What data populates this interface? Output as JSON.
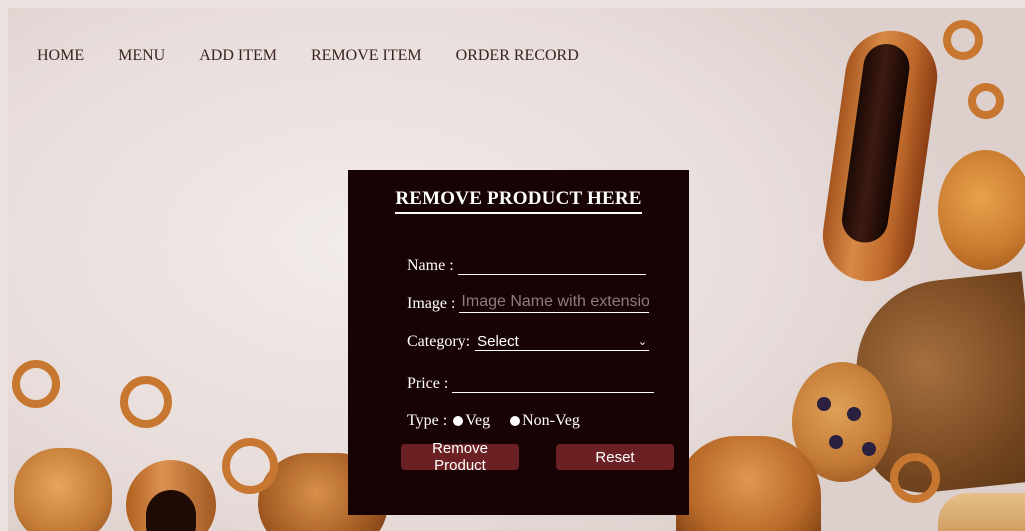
{
  "nav": {
    "items": [
      "HOME",
      "MENU",
      "ADD ITEM",
      "REMOVE ITEM",
      "ORDER RECORD"
    ]
  },
  "form": {
    "title": "REMOVE PRODUCT HERE",
    "name_label": "Name :",
    "name_value": "",
    "image_label": "Image :",
    "image_placeholder": "Image Name with extension",
    "category_label": "Category:",
    "category_selected": "Select",
    "price_label": "Price :",
    "price_value": "",
    "type_label": "Type :",
    "type_options": [
      "Veg",
      "Non-Veg"
    ],
    "remove_button": "Remove Product",
    "reset_button": "Reset"
  },
  "colors": {
    "panel_bg": "#180304",
    "button_bg": "#6b2124",
    "nav_text": "#3a2320"
  },
  "icons": {
    "select_arrow": "chevron-down-icon",
    "radio": "radio-dot-icon"
  }
}
